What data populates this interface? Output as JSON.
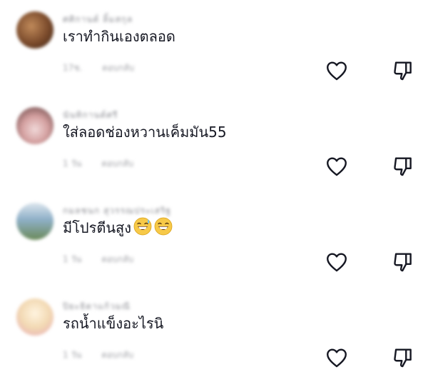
{
  "comments": [
    {
      "username": "ศศิกานต์ ลิ้มสกุล",
      "text": "เราทำกินเองตลอด",
      "meta_time": "17ช.",
      "meta_reply": "ตอบกลับ",
      "avatar_colors": [
        "#7a4a2b",
        "#c08a5a",
        "#3a2418"
      ]
    },
    {
      "username": "นันทิกานต์ศรี",
      "text": "ใส่ลอดช่องหวานเค็มมัน55",
      "meta_time": "1 วัน",
      "meta_reply": "ตอบกลับ",
      "avatar_colors": [
        "#d4a0a0",
        "#5a3a3a",
        "#f0d8d8"
      ]
    },
    {
      "username": "กมลชนก สุวรรณประเสริฐ",
      "text": "มีโปรตีนสูง",
      "emojis": [
        "sweat-grin",
        "grin"
      ],
      "meta_time": "1 วัน",
      "meta_reply": "ตอบกลับ",
      "avatar_colors": [
        "#8fb0c8",
        "#6b8a5a",
        "#dde6ee"
      ]
    },
    {
      "username": "ปิยะธิดาแก้วมณี",
      "text": "รถน้ำแข็งอะไรนิ",
      "meta_time": "1 วัน",
      "meta_reply": "ตอบกลับ",
      "avatar_colors": [
        "#f2d9b3",
        "#e8a8b8",
        "#fff4e0"
      ]
    }
  ],
  "icons": {
    "like": "heart-outline-icon",
    "dislike": "thumbs-down-outline-icon"
  },
  "colors": {
    "text": "#161823",
    "icon": "#161823",
    "muted": "#a0a1a6"
  }
}
